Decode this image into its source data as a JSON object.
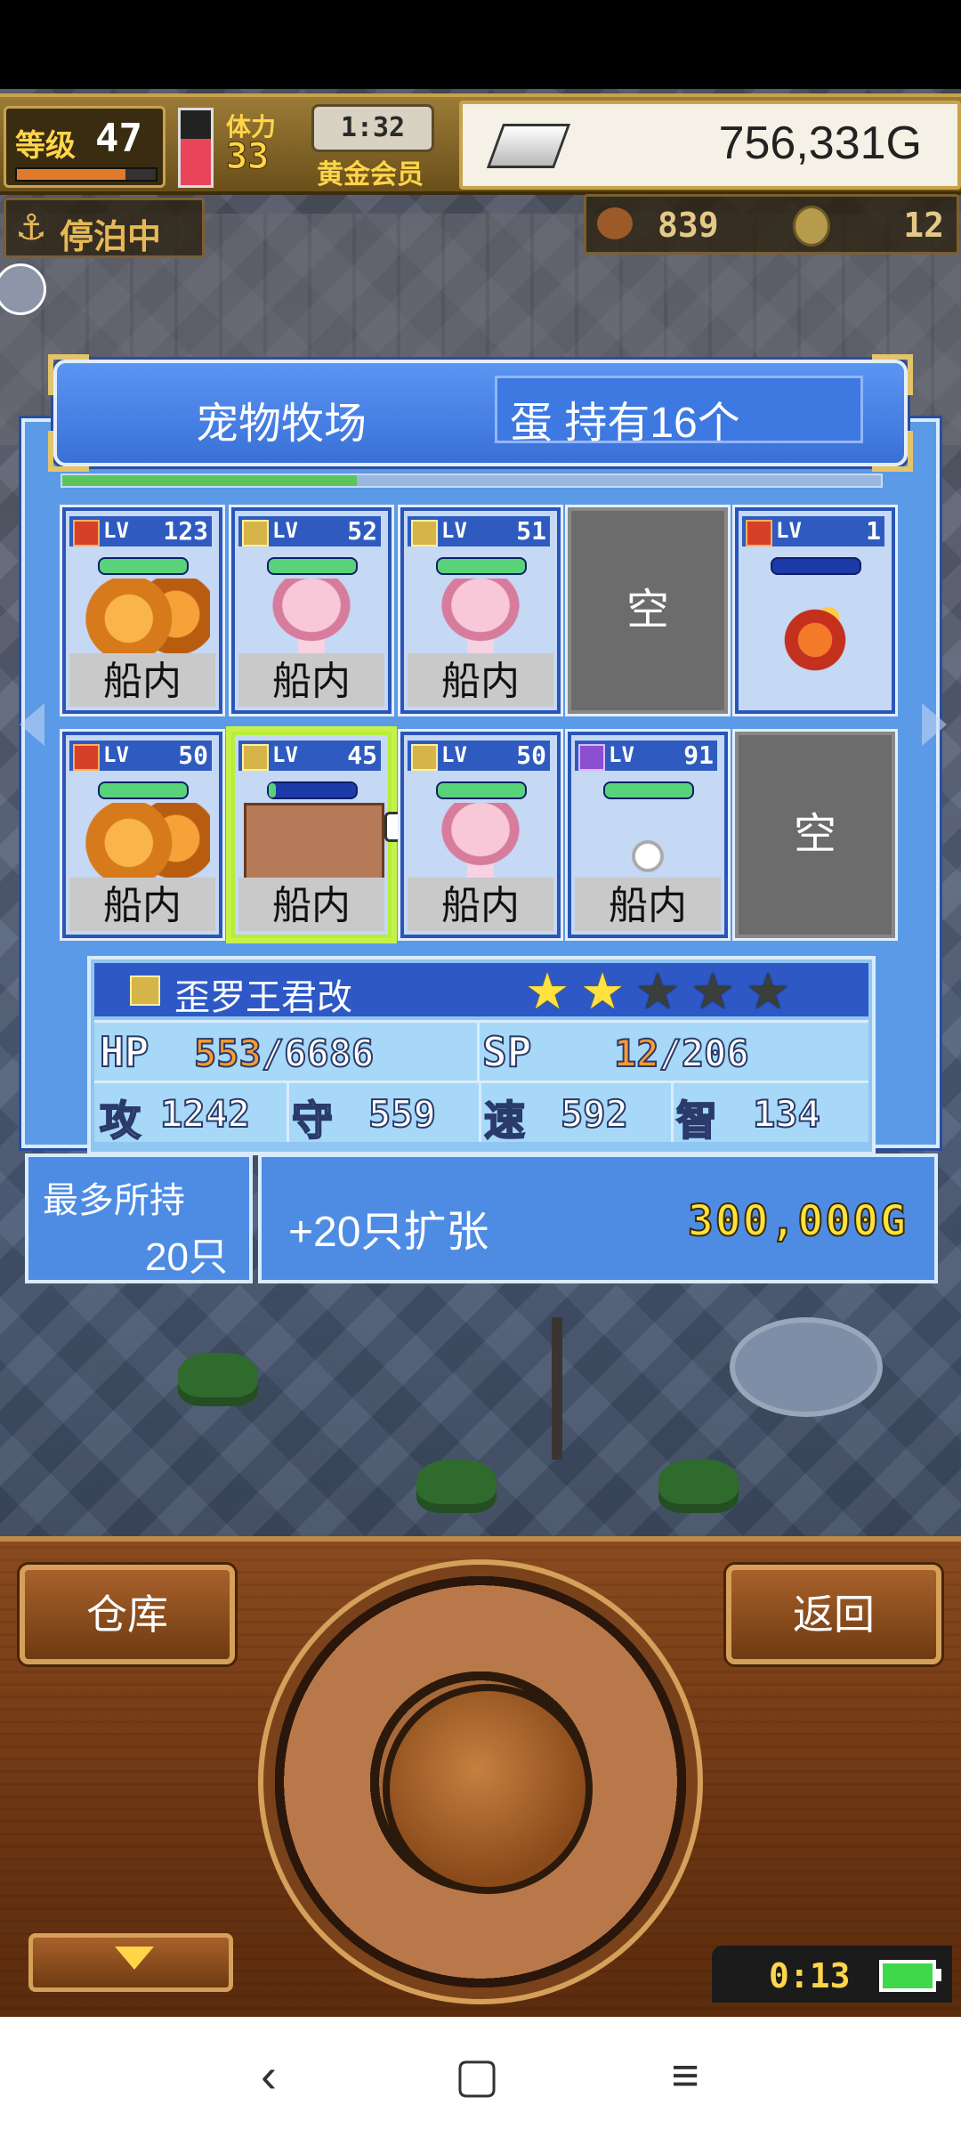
{
  "hud": {
    "level_label": "等级",
    "level": "47",
    "stamina_label": "体力",
    "stamina": "33",
    "timer": "1:32",
    "member_label": "黄金会员",
    "gold": "756,331G",
    "dock_label": "停泊中",
    "resource_a": "839",
    "resource_b": "12"
  },
  "dialog": {
    "title": "宠物牧场",
    "eggs_label": "蛋 持有16个",
    "empty_label": "空",
    "lv_label": "LV",
    "slots": [
      {
        "element": "fire",
        "lv": "123",
        "location": "船内"
      },
      {
        "element": "thunder",
        "lv": "52",
        "location": "船内"
      },
      {
        "element": "thunder",
        "lv": "51",
        "location": "船内"
      },
      {
        "empty": true
      },
      {
        "element": "fire",
        "lv": "1",
        "location": ""
      },
      {
        "element": "fire",
        "lv": "50",
        "location": "船内"
      },
      {
        "element": "thunder",
        "lv": "45",
        "location": "船内"
      },
      {
        "element": "thunder",
        "lv": "50",
        "location": "船内"
      },
      {
        "element": "psy",
        "lv": "91",
        "location": "船内"
      },
      {
        "empty": true
      }
    ]
  },
  "detail": {
    "name": "歪罗王君改",
    "stars_filled": 2,
    "stars_total": 5,
    "hp_label": "HP",
    "hp_current": "553",
    "hp_max": "/6686",
    "sp_label": "SP",
    "sp_current": "12",
    "sp_max": "/206",
    "atk_label": "攻",
    "atk": "1242",
    "def_label": "守",
    "def": "559",
    "spd_label": "速",
    "spd": "592",
    "int_label": "智",
    "int": "134"
  },
  "capacity": {
    "label": "最多所持",
    "value": "20只",
    "expand_label": "+20只扩张",
    "expand_price": "300,000G"
  },
  "controls": {
    "warehouse": "仓库",
    "back": "返回",
    "clock": "0:13"
  },
  "sysnav": {
    "back": "‹",
    "home": "▢",
    "menu": "≡"
  },
  "colors": {
    "dialog_blue": "#5b9ae6",
    "gold_text": "#ffe23d",
    "selected_border": "#c4f24a"
  }
}
